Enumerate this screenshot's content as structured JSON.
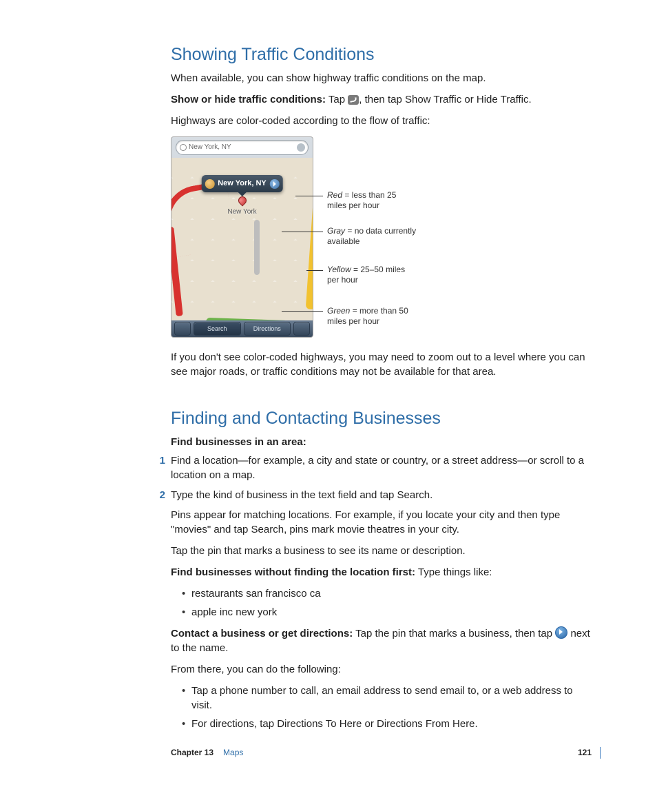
{
  "section1": {
    "heading": "Showing Traffic Conditions",
    "intro": "When available, you can show highway traffic conditions on the map.",
    "instr_label": "Show or hide traffic conditions:",
    "instr_pre": "  Tap ",
    "instr_post": ", then tap Show Traffic or Hide Traffic.",
    "legend_intro": "Highways are color-coded according to the flow of traffic:",
    "after_fig": "If you don't see color-coded highways, you may need to zoom out to a level where you can see major roads, or traffic conditions may not be available for that area."
  },
  "figure": {
    "search_value": "New York, NY",
    "callout_label": "New York, NY",
    "city_label": "New York",
    "toolbar": {
      "search": "Search",
      "directions": "Directions"
    },
    "anno": {
      "red": {
        "label": "Red",
        "text": " = less than 25 miles per hour"
      },
      "gray": {
        "label": "Gray",
        "text": " = no data currently available"
      },
      "yellow": {
        "label": "Yellow",
        "text": " = 25–50 miles per hour"
      },
      "green": {
        "label": "Green",
        "text": " = more than 50 miles per hour"
      }
    }
  },
  "section2": {
    "heading": "Finding and Contacting Businesses",
    "subhead": "Find businesses in an area:",
    "steps": {
      "1": "Find a location—for example, a city and state or country, or a street address—or scroll to a location on a map.",
      "2": "Type the kind of business in the text field and tap Search."
    },
    "pins_para": "Pins appear for matching locations. For example, if you locate your city and then type \"movies\" and tap Search, pins mark movie theatres in your city.",
    "tap_pin": "Tap the pin that marks a business to see its name or description.",
    "find_without_label": "Find businesses without finding the location first:",
    "find_without_text": "  Type things like:",
    "examples": {
      "a": "restaurants san francisco ca",
      "b": "apple inc new york"
    },
    "contact_label": "Contact a business or get directions:",
    "contact_pre": "  Tap the pin that marks a business, then tap ",
    "contact_post": " next to the name.",
    "from_there": "From there, you can do the following:",
    "actions": {
      "a": "Tap a phone number to call, an email address to send email to, or a web address to visit.",
      "b": "For directions, tap Directions To Here or Directions From Here."
    }
  },
  "footer": {
    "chapter": "Chapter 13",
    "section": "Maps",
    "page": "121"
  },
  "labels": {
    "num1": "1",
    "num2": "2",
    "bullet": "•"
  }
}
